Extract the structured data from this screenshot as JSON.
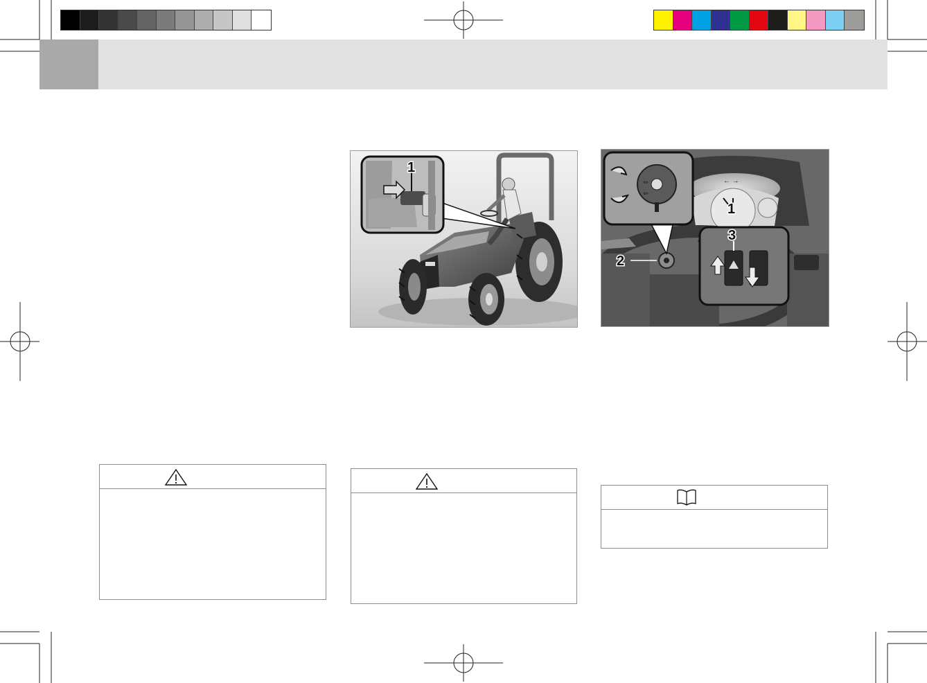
{
  "print_marks": {
    "grayscale_swatches": [
      "#000000",
      "#1c1c1c",
      "#333333",
      "#4a4a4a",
      "#636363",
      "#7b7b7b",
      "#959595",
      "#adadad",
      "#c6c6c6",
      "#e0e0e0",
      "#ffffff"
    ],
    "color_swatches": [
      "#fff200",
      "#e6007e",
      "#00a0e3",
      "#2e3192",
      "#009a44",
      "#e30613",
      "#1d1d1b",
      "#fff685",
      "#f49ac1",
      "#7dd0f2",
      "#9d9d9c"
    ]
  },
  "figure_left": {
    "callouts": [
      "1"
    ]
  },
  "figure_right": {
    "callouts": [
      "1",
      "2",
      "3"
    ]
  },
  "notices": [
    {
      "icon": "warning-triangle-icon"
    },
    {
      "icon": "warning-triangle-icon"
    },
    {
      "icon": "open-book-icon"
    }
  ]
}
